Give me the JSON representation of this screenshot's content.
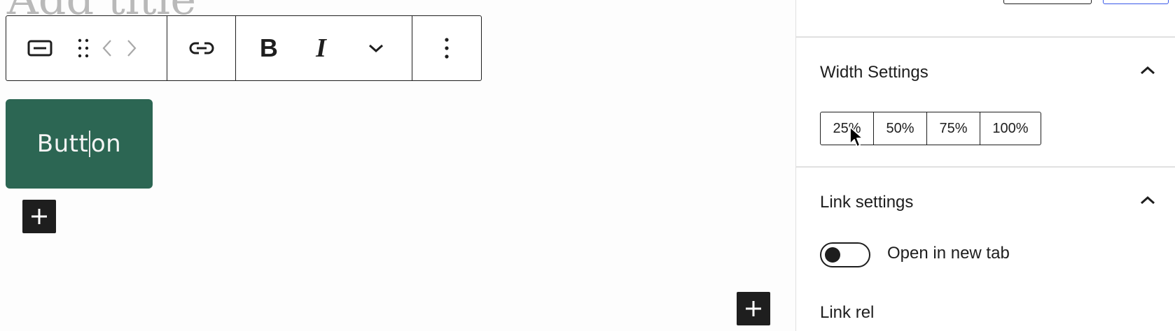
{
  "editor": {
    "title_placeholder": "Add title",
    "toolbar": {
      "block_type_icon": "button-block-icon",
      "drag_icon": "drag-handle-icon",
      "move_left_icon": "chevron-left-icon",
      "move_right_icon": "chevron-right-icon",
      "link_icon": "link-icon",
      "bold_label": "B",
      "italic_label": "I",
      "more_formats_icon": "chevron-down-icon",
      "options_icon": "more-vertical-icon"
    },
    "button_text_before_caret": "Butt",
    "button_text_after_caret": "on",
    "button_color": "#2c6653"
  },
  "sidebar": {
    "width_settings": {
      "title": "Width Settings",
      "options": [
        "25%",
        "50%",
        "75%",
        "100%"
      ]
    },
    "link_settings": {
      "title": "Link settings",
      "open_new_tab_label": "Open in new tab",
      "open_new_tab_enabled": false,
      "link_rel_label": "Link rel"
    }
  },
  "accent_color": "#3858e9"
}
